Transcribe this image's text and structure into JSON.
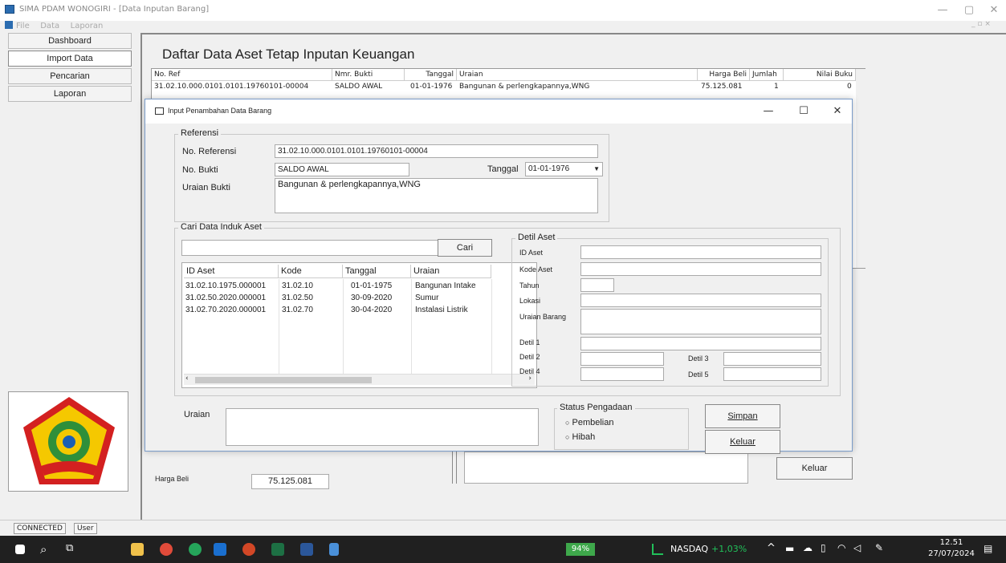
{
  "window": {
    "title": "SIMA PDAM WONOGIRI - [Data Inputan Barang]",
    "menu": [
      "File",
      "Data",
      "Laporan"
    ]
  },
  "nav": {
    "items": [
      "Dashboard",
      "Import Data",
      "Pencarian",
      "Laporan"
    ],
    "active": "Import Data"
  },
  "main": {
    "title": "Daftar Data Aset Tetap Inputan Keuangan",
    "table": {
      "columns": [
        "No. Ref",
        "Nmr. Bukti",
        "Tanggal",
        "Uraian",
        "Harga Beli",
        "Jumlah",
        "Nilai Buku"
      ],
      "first_row": [
        "31.02.10.000.0101.0101.19760101-00004",
        "SALDO AWAL",
        "01-01-1976",
        "Bangunan & perlengkapannya,WNG",
        "75.125.081",
        "1",
        "0"
      ]
    },
    "harga_beli_label": "Harga Beli",
    "harga_beli_value": "75.125.081",
    "keluar_behind": "Keluar"
  },
  "dialog": {
    "title": "Input Penambahan Data Barang",
    "referensi": {
      "group": "Referensi",
      "no_referensi_label": "No. Referensi",
      "no_referensi": "31.02.10.000.0101.0101.19760101-00004",
      "no_bukti_label": "No. Bukti",
      "no_bukti": "SALDO AWAL",
      "tanggal_label": "Tanggal",
      "tanggal": "01-01-1976",
      "uraian_bukti_label": "Uraian Bukti",
      "uraian_bukti": "Bangunan & perlengkapannya,WNG"
    },
    "cari": {
      "group": "Cari Data Induk Aset",
      "search_value": "",
      "button": "Cari",
      "columns": [
        "ID Aset",
        "Kode",
        "Tanggal",
        "Uraian"
      ],
      "rows": [
        [
          "31.02.10.1975.000001",
          "31.02.10",
          "01-01-1975",
          "Bangunan Intake"
        ],
        [
          "31.02.50.2020.000001",
          "31.02.50",
          "30-09-2020",
          "Sumur"
        ],
        [
          "31.02.70.2020.000001",
          "31.02.70",
          "30-04-2020",
          "Instalasi Listrik"
        ]
      ]
    },
    "detil": {
      "group": "Detil Aset",
      "id_aset": "ID Aset",
      "kode_aset": "Kode Aset",
      "tahun": "Tahun",
      "lokasi": "Lokasi",
      "uraian_barang": "Uraian Barang",
      "detil1": "Detil 1",
      "detil2": "Detil 2",
      "detil3": "Detil 3",
      "detil4": "Detil 4",
      "detil5": "Detil 5"
    },
    "uraian_label": "Uraian",
    "status": {
      "group": "Status Pengadaan",
      "opt1": "Pembelian",
      "opt2": "Hibah"
    },
    "simpan": "Simpan",
    "keluar": "Keluar"
  },
  "statusbar": {
    "connection": "CONNECTED",
    "user": "User"
  },
  "taskbar": {
    "battery": "94%",
    "ticker": "NASDAQ",
    "ticker_change": "+1,03%",
    "time": "12.51",
    "date": "27/07/2024"
  },
  "colors": {
    "accent": "#0078d7",
    "logo_yellow": "#f5c800",
    "logo_red": "#d32020",
    "logo_green": "#2f8f3a",
    "ticker_green": "#21c05a"
  }
}
